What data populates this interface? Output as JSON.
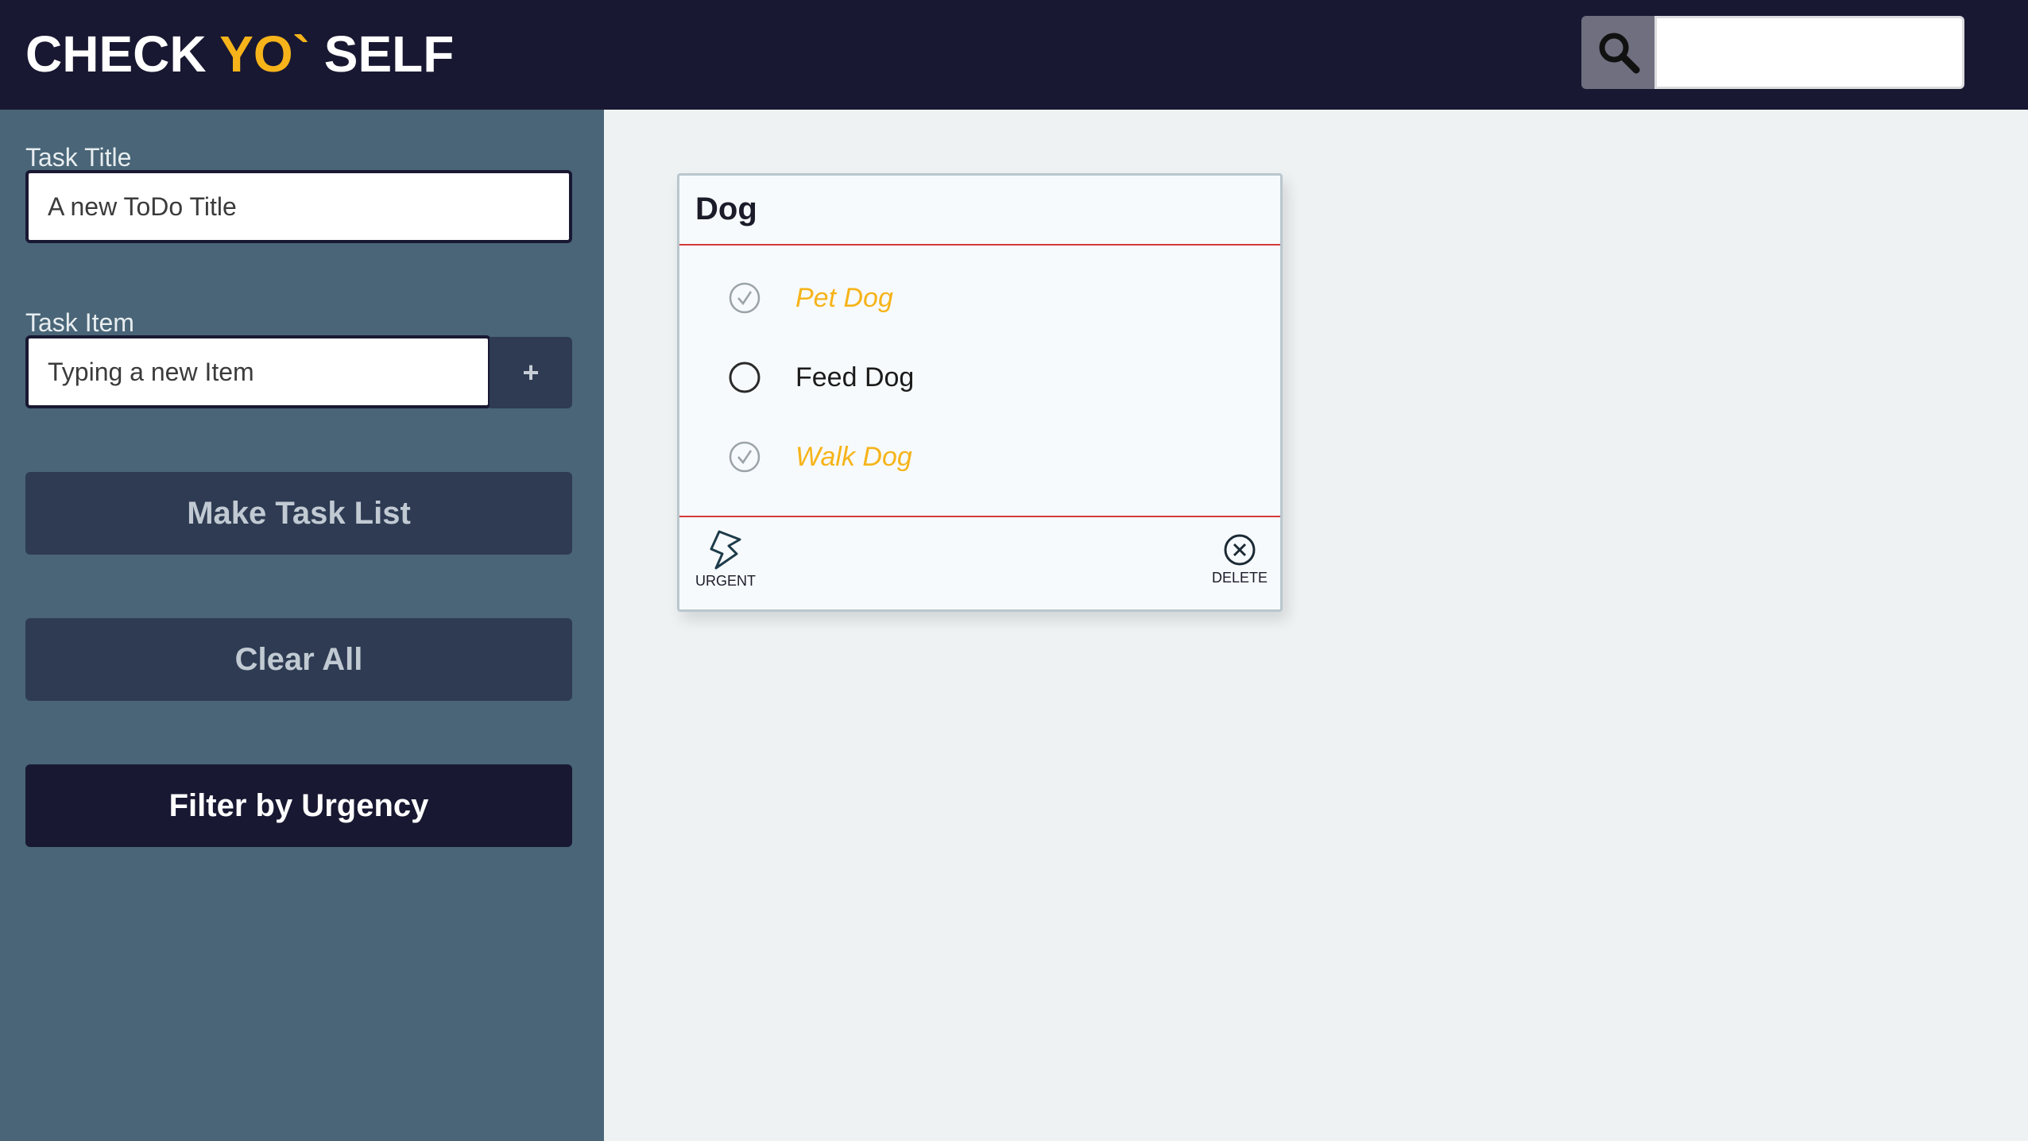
{
  "header": {
    "logo_part1": "CHECK ",
    "logo_accent": "YO`",
    "logo_part2": " SELF",
    "search_icon": "magnifier-icon",
    "search_value": ""
  },
  "sidebar": {
    "task_title_label": "Task Title",
    "task_title_placeholder": "A new ToDo Title",
    "task_item_label": "Task Item",
    "task_item_placeholder": "Typing a new Item",
    "add_item_label": "+",
    "make_task_list_label": "Make Task List",
    "clear_all_label": "Clear All",
    "filter_urgency_label": "Filter by Urgency"
  },
  "card": {
    "title": "Dog",
    "items": [
      {
        "text": "Pet Dog",
        "done": true,
        "icon": "checked-circle-icon"
      },
      {
        "text": "Feed Dog",
        "done": false,
        "icon": "empty-circle-icon"
      },
      {
        "text": "Walk Dog",
        "done": true,
        "icon": "checked-circle-icon"
      }
    ],
    "urgent_label": "URGENT",
    "delete_label": "DELETE"
  },
  "colors": {
    "header_bg": "#191832",
    "accent": "#f6b41a",
    "sidebar_bg": "#496577",
    "button_bg": "#2e3b52",
    "card_divider": "#d43a3a"
  }
}
